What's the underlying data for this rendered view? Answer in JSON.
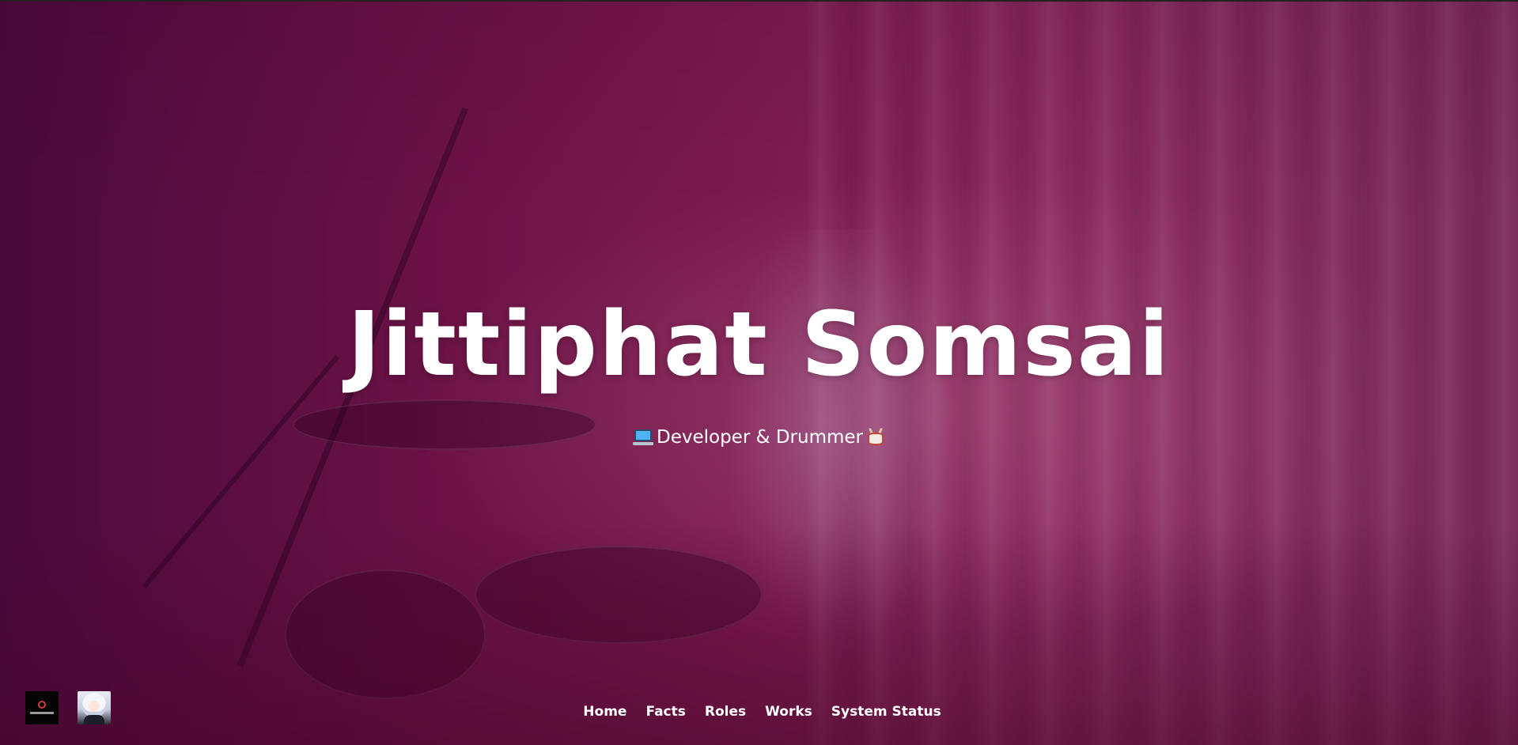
{
  "hero": {
    "name": "Jittiphat Somsai",
    "subtitle_icon_left": "laptop-icon",
    "subtitle_text": "Developer & Drummer",
    "subtitle_icon_right": "drum-icon"
  },
  "thumbnails": [
    {
      "icon": "brand-logo-thumbnail"
    },
    {
      "icon": "anime-avatar-thumbnail"
    }
  ],
  "nav": {
    "items": [
      {
        "label": "Home"
      },
      {
        "label": "Facts"
      },
      {
        "label": "Roles"
      },
      {
        "label": "Works"
      },
      {
        "label": "System Status"
      }
    ]
  },
  "colors": {
    "overlay": "#7a1a4e",
    "text": "#ffffff"
  }
}
